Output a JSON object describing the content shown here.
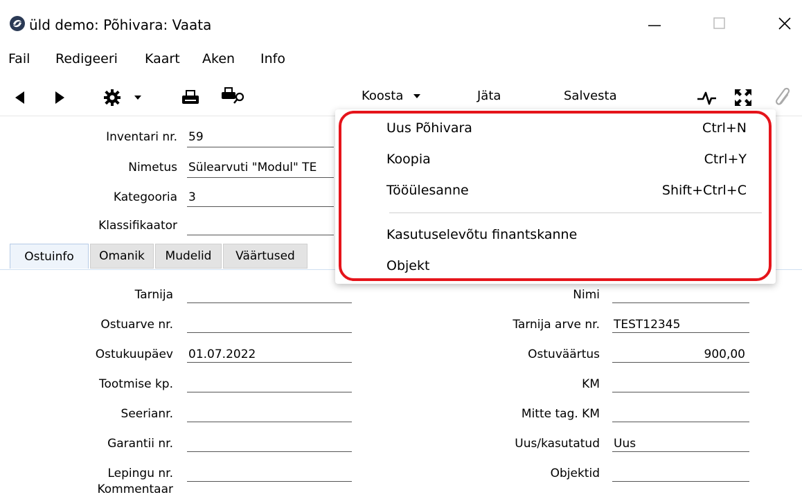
{
  "window": {
    "title": "üld demo: Põhivara: Vaata",
    "icons": {
      "app": "app-logo-icon",
      "minimize": "minimize-icon",
      "maximize": "maximize-icon",
      "close": "close-icon"
    }
  },
  "menubar": {
    "items": [
      "Fail",
      "Redigeeri",
      "Kaart",
      "Aken",
      "Info"
    ]
  },
  "toolbar": {
    "koosta": "Koosta",
    "jata": "Jäta",
    "salvesta": "Salvesta",
    "icons": [
      "back-arrow-icon",
      "forward-arrow-icon",
      "gear-icon",
      "print-icon",
      "print-preview-icon",
      "activity-icon",
      "expand-icon",
      "attachment-icon"
    ]
  },
  "header_fields": [
    {
      "label": "Inventari nr.",
      "value": "59"
    },
    {
      "label": "Nimetus",
      "value": "Sülearvuti \"Modul\" TE"
    },
    {
      "label": "Kategooria",
      "value": "3"
    },
    {
      "label": "Klassifikaator",
      "value": ""
    }
  ],
  "tabs": [
    "Ostuinfo",
    "Omanik",
    "Mudelid",
    "Väärtused"
  ],
  "left_fields": [
    {
      "label": "Tarnija",
      "value": ""
    },
    {
      "label": "Ostuarve nr.",
      "value": ""
    },
    {
      "label": "Ostukuupäev",
      "value": "01.07.2022"
    },
    {
      "label": "Tootmise kp.",
      "value": ""
    },
    {
      "label": "Seerianr.",
      "value": ""
    },
    {
      "label": "Garantii nr.",
      "value": ""
    },
    {
      "label": "Lepingu nr.",
      "value": ""
    },
    {
      "label": "Kommentaar",
      "value": ""
    }
  ],
  "right_fields": [
    {
      "label": "Nimi",
      "value": ""
    },
    {
      "label": "Tarnija arve nr.",
      "value": "TEST12345"
    },
    {
      "label": "Ostuväärtus",
      "value": "900,00"
    },
    {
      "label": "KM",
      "value": ""
    },
    {
      "label": "Mitte tag. KM",
      "value": ""
    },
    {
      "label": "Uus/kasutatud",
      "value": "Uus"
    },
    {
      "label": "Objektid",
      "value": ""
    }
  ],
  "dropdown": {
    "items": [
      {
        "label": "Uus Põhivara",
        "shortcut": "Ctrl+N"
      },
      {
        "label": "Koopia",
        "shortcut": "Ctrl+Y"
      },
      {
        "label": "Tööülesanne",
        "shortcut": "Shift+Ctrl+C"
      },
      {
        "label": "Kasutuselevõtu finantskanne",
        "shortcut": ""
      },
      {
        "label": "Objekt",
        "shortcut": ""
      }
    ]
  },
  "colors": {
    "highlight": "#e5141b",
    "active_tab": "#eef4fb",
    "tab": "#e3e3e3"
  }
}
